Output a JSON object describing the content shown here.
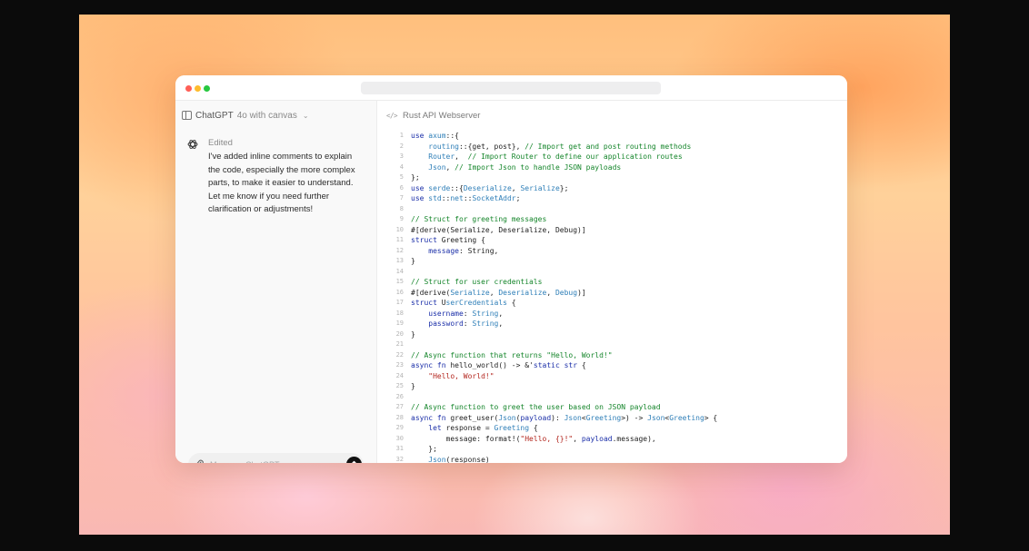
{
  "app": {
    "model_name": "ChatGPT",
    "model_variant": "4o with canvas"
  },
  "chat": {
    "status": "Edited",
    "message": "I've added inline comments to explain the code, especially the more complex parts, to make it easier to understand. Let me know if you need further clarification or adjustments!",
    "composer_placeholder": "Message ChatGPT"
  },
  "canvas": {
    "title": "Rust API Webserver",
    "code_lines": [
      [
        [
          "kw",
          "use "
        ],
        [
          "ty",
          "axum"
        ],
        [
          "tx",
          "::{"
        ]
      ],
      [
        [
          "tx",
          "    "
        ],
        [
          "ty",
          "routing"
        ],
        [
          "tx",
          "::{get, post}, "
        ],
        [
          "cm",
          "// Import get and post routing methods"
        ]
      ],
      [
        [
          "tx",
          "    "
        ],
        [
          "ty",
          "Router"
        ],
        [
          "tx",
          ",  "
        ],
        [
          "cm",
          "// Import Router to define our application routes"
        ]
      ],
      [
        [
          "tx",
          "    "
        ],
        [
          "ty",
          "Json"
        ],
        [
          "tx",
          ", "
        ],
        [
          "cm",
          "// Import Json to handle JSON payloads"
        ]
      ],
      [
        [
          "tx",
          "};"
        ]
      ],
      [
        [
          "kw",
          "use "
        ],
        [
          "ty",
          "serde"
        ],
        [
          "tx",
          "::{"
        ],
        [
          "ty",
          "Deserialize"
        ],
        [
          "tx",
          ", "
        ],
        [
          "ty",
          "Serialize"
        ],
        [
          "tx",
          "};"
        ]
      ],
      [
        [
          "kw",
          "use "
        ],
        [
          "ty",
          "std"
        ],
        [
          "tx",
          "::"
        ],
        [
          "ty",
          "net"
        ],
        [
          "tx",
          "::"
        ],
        [
          "ty",
          "SocketAddr"
        ],
        [
          "tx",
          ";"
        ]
      ],
      [],
      [
        [
          "cm",
          "// Struct for greeting messages"
        ]
      ],
      [
        [
          "tx",
          "#[derive(Serialize, Deserialize, Debug)]"
        ]
      ],
      [
        [
          "kw",
          "struct "
        ],
        [
          "tx",
          "Greeting {"
        ]
      ],
      [
        [
          "tx",
          "    "
        ],
        [
          "kw",
          "message"
        ],
        [
          "tx",
          ": String,"
        ]
      ],
      [
        [
          "tx",
          "}"
        ]
      ],
      [],
      [
        [
          "cm",
          "// Struct for user credentials"
        ]
      ],
      [
        [
          "tx",
          "#[derive("
        ],
        [
          "ty",
          "Serialize"
        ],
        [
          "tx",
          ", "
        ],
        [
          "ty",
          "Deserialize"
        ],
        [
          "tx",
          ", "
        ],
        [
          "ty",
          "Debug"
        ],
        [
          "tx",
          ")]"
        ]
      ],
      [
        [
          "kw",
          "struct "
        ],
        [
          "tx",
          "U"
        ],
        [
          "ty",
          "serCredentials"
        ],
        [
          "tx",
          " {"
        ]
      ],
      [
        [
          "tx",
          "    "
        ],
        [
          "kw",
          "username"
        ],
        [
          "tx",
          ": "
        ],
        [
          "ty",
          "String"
        ],
        [
          "tx",
          ","
        ]
      ],
      [
        [
          "tx",
          "    "
        ],
        [
          "kw",
          "password"
        ],
        [
          "tx",
          ": "
        ],
        [
          "ty",
          "String"
        ],
        [
          "tx",
          ","
        ]
      ],
      [
        [
          "tx",
          "}"
        ]
      ],
      [],
      [
        [
          "cm",
          "// Async function that returns \"Hello, World!\""
        ]
      ],
      [
        [
          "kw",
          "async fn "
        ],
        [
          "tx",
          "hello_world() -> &'"
        ],
        [
          "kw",
          "static str "
        ],
        [
          "tx",
          "{"
        ]
      ],
      [
        [
          "tx",
          "    "
        ],
        [
          "st",
          "\"Hello, World!\""
        ]
      ],
      [
        [
          "tx",
          "}"
        ]
      ],
      [],
      [
        [
          "cm",
          "// Async function to greet the user based on JSON payload"
        ]
      ],
      [
        [
          "kw",
          "async fn "
        ],
        [
          "tx",
          "greet_user("
        ],
        [
          "ty",
          "Json"
        ],
        [
          "tx",
          "("
        ],
        [
          "kw",
          "payload"
        ],
        [
          "tx",
          "): "
        ],
        [
          "ty",
          "Json"
        ],
        [
          "tx",
          "<"
        ],
        [
          "ty",
          "Greeting"
        ],
        [
          "tx",
          ">) -> "
        ],
        [
          "ty",
          "Json"
        ],
        [
          "tx",
          "<"
        ],
        [
          "ty",
          "Greeting"
        ],
        [
          "tx",
          "> {"
        ]
      ],
      [
        [
          "tx",
          "    "
        ],
        [
          "kw",
          "let "
        ],
        [
          "tx",
          "response = "
        ],
        [
          "ty",
          "Greeting"
        ],
        [
          "tx",
          " {"
        ]
      ],
      [
        [
          "tx",
          "        message: format!("
        ],
        [
          "st",
          "\"Hello, {}!\""
        ],
        [
          "tx",
          ", "
        ],
        [
          "kw",
          "payload"
        ],
        [
          "tx",
          ".message),"
        ]
      ],
      [
        [
          "tx",
          "    };"
        ]
      ],
      [
        [
          "tx",
          "    "
        ],
        [
          "ty",
          "Json"
        ],
        [
          "tx",
          "(response)"
        ]
      ]
    ]
  },
  "colors": {
    "keyword": "#1a2ea8",
    "comment": "#14852a",
    "type": "#2f7fb8",
    "string": "#b3261e",
    "send_button": "#111111"
  },
  "icons": [
    "sidebar-icon",
    "chevron-down-icon",
    "openai-logo-icon",
    "paperclip-icon",
    "arrow-up-icon",
    "code-icon"
  ]
}
